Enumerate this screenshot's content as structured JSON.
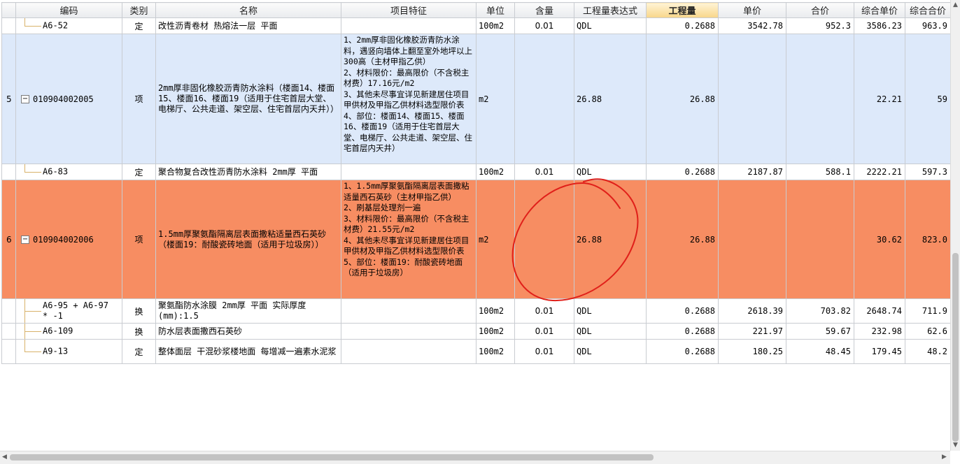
{
  "columns": [
    "",
    "编码",
    "类别",
    "名称",
    "项目特征",
    "单位",
    "含量",
    "工程量表达式",
    "工程量",
    "单价",
    "合价",
    "综合单价",
    "综合合价"
  ],
  "active_column": "工程量",
  "rows": [
    {
      "idx": "",
      "code": "A6-52",
      "type": "定",
      "name": "改性沥青卷材 热熔法一层 平面",
      "feature": "",
      "unit": "100m2",
      "content": "0.01",
      "expr": "QDL",
      "qty": "0.2688",
      "price": "3542.78",
      "total": "952.3",
      "comp_price": "3586.23",
      "comp_total": "963.9"
    },
    {
      "idx": "5",
      "code": "010904002005",
      "type": "项",
      "name": "2mm厚非固化橡胶沥青防水涂料（楼面14、楼面15、楼面16、楼面19（适用于住宅首层大堂、电梯厅、公共走道、架空层、住宅首层内天井））",
      "feature": "1、2mm厚非固化橡胶沥青防水涂料，遇竖向墙体上翻至室外地坪以上300高（主材甲指乙供）\n2、材料限价：最高限价（不含税主材费）17.16元/m2\n3、其他未尽事宜详见新建居住项目甲供材及甲指乙供材料选型限价表\n4、部位：楼面14、楼面15、楼面16、楼面19（适用于住宅首层大堂、电梯厅、公共走道、架空层、住宅首层内天井）",
      "unit": "m2",
      "content": "",
      "expr": "26.88",
      "qty": "26.88",
      "price": "",
      "total": "",
      "comp_price": "22.21",
      "comp_total": "59"
    },
    {
      "idx": "",
      "code": "A6-83",
      "type": "定",
      "name": "聚合物复合改性沥青防水涂料 2mm厚 平面",
      "feature": "",
      "unit": "100m2",
      "content": "0.01",
      "expr": "QDL",
      "qty": "0.2688",
      "price": "2187.87",
      "total": "588.1",
      "comp_price": "2222.21",
      "comp_total": "597.3"
    },
    {
      "idx": "6",
      "code": "010904002006",
      "type": "项",
      "name": "1.5mm厚聚氨酯隔离层表面撒粘适量西石英砂（楼面19：耐酸瓷砖地面（适用于垃圾房））",
      "feature": "1、1.5mm厚聚氨酯隔离层表面撒粘适量西石英砂（主材甲指乙供）\n2、刷基层处理剂一遍\n3、材料限价：最高限价（不含税主材费）21.55元/m2\n4、其他未尽事宜详见新建居住项目甲供材及甲指乙供材料选型限价表\n5、部位：楼面19：耐酸瓷砖地面（适用于垃圾房）",
      "unit": "m2",
      "content": "",
      "expr": "26.88",
      "qty": "26.88",
      "price": "",
      "total": "",
      "comp_price": "30.62",
      "comp_total": "823.0"
    },
    {
      "idx": "",
      "code": "A6-95 + A6-97 * -1",
      "type": "换",
      "name": "聚氨酯防水涂膜 2mm厚 平面  实际厚度(mm):1.5",
      "feature": "",
      "unit": "100m2",
      "content": "0.01",
      "expr": "QDL",
      "qty": "0.2688",
      "price": "2618.39",
      "total": "703.82",
      "comp_price": "2648.74",
      "comp_total": "711.9"
    },
    {
      "idx": "",
      "code": "A6-109",
      "type": "换",
      "name": "防水层表面撒西石英砂",
      "feature": "",
      "unit": "100m2",
      "content": "0.01",
      "expr": "QDL",
      "qty": "0.2688",
      "price": "221.97",
      "total": "59.67",
      "comp_price": "232.98",
      "comp_total": "62.6"
    },
    {
      "idx": "",
      "code": "A9-13",
      "type": "定",
      "name": "整体面层 干混砂浆楼地面 每增减一遍素水泥浆",
      "feature": "",
      "unit": "100m2",
      "content": "0.01",
      "expr": "QDL",
      "qty": "0.2688",
      "price": "180.25",
      "total": "48.45",
      "comp_price": "179.45",
      "comp_total": "48.2"
    }
  ],
  "colors": {
    "header_bg": "#eceef1",
    "active_header": "#f8d68a",
    "row_item_blue": "#dde9fa",
    "row_selected_orange": "#f78d62",
    "annotation_circle": "#e0201a",
    "grid_line": "#c9ccd1"
  },
  "annotation": "hand-drawn red circle around the 含量/工程量表达式 cells of row 6"
}
